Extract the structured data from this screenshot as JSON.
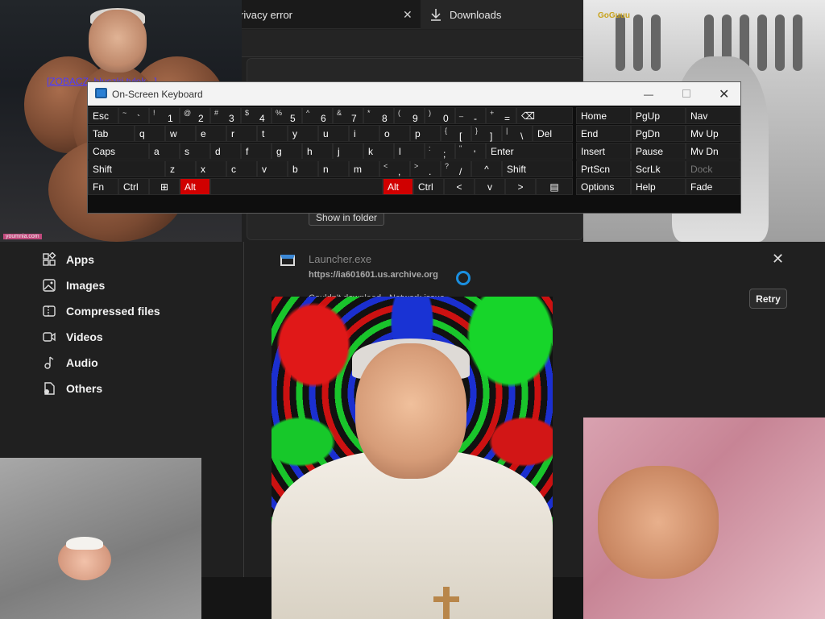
{
  "browser": {
    "tabs": [
      {
        "label": "rivacy error",
        "close": "✕"
      },
      {
        "label": "Downloads"
      }
    ],
    "show_in_folder": "Show in folder"
  },
  "sidebar": {
    "items": [
      {
        "label": "Apps",
        "icon": "apps-icon"
      },
      {
        "label": "Images",
        "icon": "image-icon"
      },
      {
        "label": "Compressed files",
        "icon": "zip-icon"
      },
      {
        "label": "Videos",
        "icon": "video-icon"
      },
      {
        "label": "Audio",
        "icon": "music-icon"
      },
      {
        "label": "Others",
        "icon": "file-icon"
      }
    ]
  },
  "download": {
    "filename": "Launcher.exe",
    "url": "https://ia601601.us.archive.org",
    "status": "Couldn't download - Network issue",
    "retry": "Retry",
    "close": "✕"
  },
  "overlays": {
    "bodybuilder_link": "[ZOBACZ: bluszki tyłek...]",
    "bodybuilder_watermark": "youmnia.com",
    "sausage_logo": "GoGuuu"
  },
  "osk": {
    "title": "On-Screen Keyboard",
    "min": "—",
    "close": "✕",
    "row1": [
      {
        "main": "Esc"
      },
      {
        "shift": "~",
        "main": "`"
      },
      {
        "shift": "!",
        "main": "1"
      },
      {
        "shift": "@",
        "main": "2"
      },
      {
        "shift": "#",
        "main": "3"
      },
      {
        "shift": "$",
        "main": "4"
      },
      {
        "shift": "%",
        "main": "5"
      },
      {
        "shift": "^",
        "main": "6"
      },
      {
        "shift": "&",
        "main": "7"
      },
      {
        "shift": "*",
        "main": "8"
      },
      {
        "shift": "(",
        "main": "9"
      },
      {
        "shift": ")",
        "main": "0"
      },
      {
        "shift": "_",
        "main": "-"
      },
      {
        "shift": "+",
        "main": "="
      },
      {
        "main": "⌫"
      }
    ],
    "row2": [
      {
        "main": "Tab"
      },
      {
        "main": "q"
      },
      {
        "main": "w"
      },
      {
        "main": "e"
      },
      {
        "main": "r"
      },
      {
        "main": "t"
      },
      {
        "main": "y"
      },
      {
        "main": "u"
      },
      {
        "main": "i"
      },
      {
        "main": "o"
      },
      {
        "main": "p"
      },
      {
        "shift": "{",
        "main": "["
      },
      {
        "shift": "}",
        "main": "]"
      },
      {
        "shift": "|",
        "main": "\\"
      },
      {
        "main": "Del"
      }
    ],
    "row3": [
      {
        "main": "Caps"
      },
      {
        "main": "a"
      },
      {
        "main": "s"
      },
      {
        "main": "d"
      },
      {
        "main": "f"
      },
      {
        "main": "g"
      },
      {
        "main": "h"
      },
      {
        "main": "j"
      },
      {
        "main": "k"
      },
      {
        "main": "l"
      },
      {
        "shift": ":",
        "main": ";"
      },
      {
        "shift": "\"",
        "main": "'"
      },
      {
        "main": "Enter"
      }
    ],
    "row4": [
      {
        "main": "Shift"
      },
      {
        "main": "z"
      },
      {
        "main": "x"
      },
      {
        "main": "c"
      },
      {
        "main": "v"
      },
      {
        "main": "b"
      },
      {
        "main": "n"
      },
      {
        "main": "m"
      },
      {
        "shift": "<",
        "main": ","
      },
      {
        "shift": ">",
        "main": "."
      },
      {
        "shift": "?",
        "main": "/"
      },
      {
        "main": "^"
      },
      {
        "main": "Shift"
      }
    ],
    "row5": [
      {
        "main": "Fn"
      },
      {
        "main": "Ctrl"
      },
      {
        "main": "⊞"
      },
      {
        "main": "Alt"
      },
      {
        "main": ""
      },
      {
        "main": "Alt"
      },
      {
        "main": "Ctrl"
      },
      {
        "main": "<"
      },
      {
        "main": "v"
      },
      {
        "main": ">"
      },
      {
        "main": "▤"
      }
    ],
    "nav": [
      [
        "Home",
        "PgUp",
        "Nav"
      ],
      [
        "End",
        "PgDn",
        "Mv Up"
      ],
      [
        "Insert",
        "Pause",
        "Mv Dn"
      ],
      [
        "PrtScn",
        "ScrLk",
        "Dock"
      ],
      [
        "Options",
        "Help",
        "Fade"
      ]
    ]
  },
  "colors": {
    "alt_red": "#d00000",
    "spinner_blue": "#1a8fe0",
    "link_blue": "#4c3cff"
  }
}
